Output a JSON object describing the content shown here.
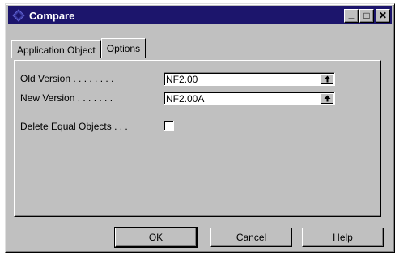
{
  "window": {
    "title": "Compare",
    "title_bar_color": "#1c156c",
    "app_icon": "cube-icon",
    "controls": {
      "minimize": "_",
      "maximize": "□",
      "close": "✕"
    }
  },
  "tabs": [
    {
      "label": "Application Object",
      "active": false
    },
    {
      "label": "Options",
      "active": true
    }
  ],
  "options": {
    "old_version_label": "Old Version . . . . . . . .",
    "old_version_value": "NF2.00",
    "new_version_label": "New Version . . . . . . .",
    "new_version_value": "NF2.00A",
    "delete_equal_label": "Delete Equal Objects . . .",
    "delete_equal_checked": false
  },
  "buttons": {
    "ok": "OK",
    "cancel": "Cancel",
    "help": "Help"
  }
}
